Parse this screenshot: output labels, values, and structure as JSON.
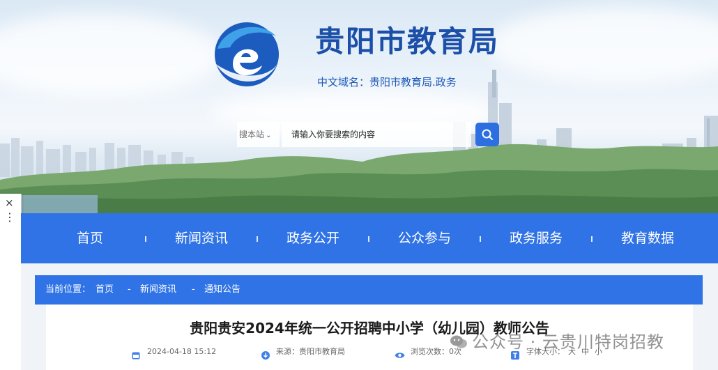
{
  "header": {
    "site_title": "贵阳市教育局",
    "domain_text": "中文域名：贵阳市教育局.政务"
  },
  "search": {
    "scope_label": "搜本站",
    "placeholder": "请输入你要搜索的内容"
  },
  "nav": {
    "items": [
      "首页",
      "新闻资讯",
      "政务公开",
      "公众参与",
      "政务服务",
      "教育数据"
    ]
  },
  "breadcrumb": {
    "prefix": "当前位置：",
    "items": [
      "首页",
      "新闻资讯",
      "通知公告"
    ],
    "separator": "-"
  },
  "article": {
    "title": "贵阳贵安2024年统一公开招聘中小学（幼儿园）教师公告",
    "date": "2024-04-18 15:12",
    "source": "来源：贵阳市教育局",
    "views": "浏览次数：0次",
    "font_size_label": "字体大小：",
    "font_sizes": [
      "大",
      "中",
      "小"
    ]
  },
  "watermark": {
    "text": "公众号 · 云贵川特岗招教"
  },
  "side_panel": {
    "close_glyph": "×",
    "more_glyph": "⋮"
  },
  "colors": {
    "nav_blue": "#2f73e6",
    "title_blue": "#1b4fa8",
    "search_button": "#2d6fe0"
  },
  "icons": [
    "logo-e-icon",
    "search-icon",
    "calendar-icon",
    "source-icon",
    "eye-icon",
    "font-size-icon",
    "wechat-icon",
    "close-icon",
    "more-icon"
  ]
}
